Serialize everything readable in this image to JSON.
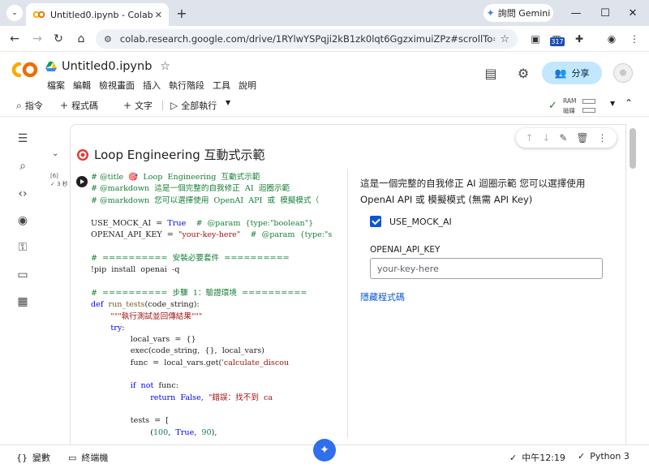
{
  "browser": {
    "tab_title": "Untitled0.ipynb - Colab",
    "tab_close": "✕",
    "new_tab": "+",
    "gemini_label": "詢問 Gemini",
    "url": "colab.research.google.com/drive/1RYlwYSPqji2kB1zk0lqt6GgzximuiZPz#scrollTo=6h8Nqy...",
    "extension_badge": "317"
  },
  "colab": {
    "logo_text": "CO",
    "notebook_title": "Untitled0.ipynb",
    "menu": [
      "檔案",
      "編輯",
      "檢視畫面",
      "插入",
      "執行階段",
      "工具",
      "說明"
    ],
    "share_label": "分享",
    "toolbar": {
      "commands": "指令",
      "add_code": "程式碼",
      "add_text": "文字",
      "run_all": "全部執行",
      "ram_label": "RAM",
      "disk_label": "磁碟"
    }
  },
  "cell": {
    "section_title": "Loop Engineering 互動式示範",
    "exec_count": "[6]",
    "exec_time": "3 秒",
    "code_lines": [
      [
        [
          "c-com",
          "# @title  🎯  Loop  Engineering  互動式示範"
        ]
      ],
      [
        [
          "c-com",
          "# @markdown  這是一個完整的自我修正  AI  迴圈示範"
        ]
      ],
      [
        [
          "c-com",
          "# @markdown  您可以選擇使用  OpenAI  API  或  模擬模式（"
        ]
      ],
      [],
      [
        [
          "c-plain",
          "USE_MOCK_AI  =  "
        ],
        [
          "c-kw",
          "True"
        ],
        [
          "c-plain",
          "    "
        ],
        [
          "c-com",
          "#  @param  {type:\"boolean\"}"
        ]
      ],
      [
        [
          "c-plain",
          "OPENAI_API_KEY  =  "
        ],
        [
          "c-str",
          "\"your-key-here\""
        ],
        [
          "c-plain",
          "    "
        ],
        [
          "c-com",
          "#  @param  {type:\"s"
        ]
      ],
      [],
      [
        [
          "c-com",
          "#  ==========  安裝必要套件  =========="
        ]
      ],
      [
        [
          "c-plain",
          "!pip  install  openai  -q"
        ]
      ],
      [],
      [
        [
          "c-com",
          "#  ==========  步驟  1：驗證環境  =========="
        ]
      ],
      [
        [
          "c-kw",
          "def"
        ],
        [
          "c-plain",
          "  "
        ],
        [
          "c-def",
          "run_tests"
        ],
        [
          "c-plain",
          "(code_string):"
        ]
      ],
      [
        [
          "c-plain",
          "        "
        ],
        [
          "c-str",
          "\"\"\"執行測試並回傳結果\"\"\""
        ]
      ],
      [
        [
          "c-plain",
          "        "
        ],
        [
          "c-kw",
          "try"
        ],
        [
          "c-plain",
          ":"
        ]
      ],
      [
        [
          "c-plain",
          "                local_vars  =  {}"
        ]
      ],
      [
        [
          "c-plain",
          "                "
        ],
        [
          "c-fn",
          "exec"
        ],
        [
          "c-plain",
          "(code_string,  {},  local_vars)"
        ]
      ],
      [
        [
          "c-plain",
          "                func  =  local_vars.get("
        ],
        [
          "c-str",
          "'calculate_discou"
        ]
      ],
      [],
      [
        [
          "c-plain",
          "                "
        ],
        [
          "c-kw",
          "if"
        ],
        [
          "c-plain",
          "  "
        ],
        [
          "c-kw",
          "not"
        ],
        [
          "c-plain",
          "  func:"
        ]
      ],
      [
        [
          "c-plain",
          "                        "
        ],
        [
          "c-kw",
          "return"
        ],
        [
          "c-plain",
          "  "
        ],
        [
          "c-kw",
          "False"
        ],
        [
          "c-plain",
          ",  "
        ],
        [
          "c-str",
          "\"錯誤：找不到  ca"
        ]
      ],
      [],
      [
        [
          "c-plain",
          "                tests  =  ["
        ]
      ],
      [
        [
          "c-plain",
          "                        ("
        ],
        [
          "c-num",
          "100"
        ],
        [
          "c-plain",
          ",  "
        ],
        [
          "c-kw",
          "True"
        ],
        [
          "c-plain",
          ",  "
        ],
        [
          "c-num",
          "90"
        ],
        [
          "c-plain",
          "),"
        ]
      ]
    ]
  },
  "form": {
    "description": "這是一個完整的自我修正 AI 迴圈示範 您可以選擇使用 OpenAI API 或 模擬模式 (無需 API Key)",
    "checkbox_label": "USE_MOCK_AI",
    "field_label": "OPENAI_API_KEY",
    "field_value": "your-key-here",
    "hide_code": "隱藏程式碼"
  },
  "status": {
    "variables": "變數",
    "terminal": "終端機",
    "time": "中午12:19",
    "runtime": "Python 3"
  },
  "colors": {
    "accent_blue": "#0b57d0",
    "share_bg": "#c2e7ff",
    "comment_green": "#188038",
    "keyword_blue": "#0000ff",
    "string_red": "#a31515",
    "colab_orange": "#f9ab00"
  }
}
